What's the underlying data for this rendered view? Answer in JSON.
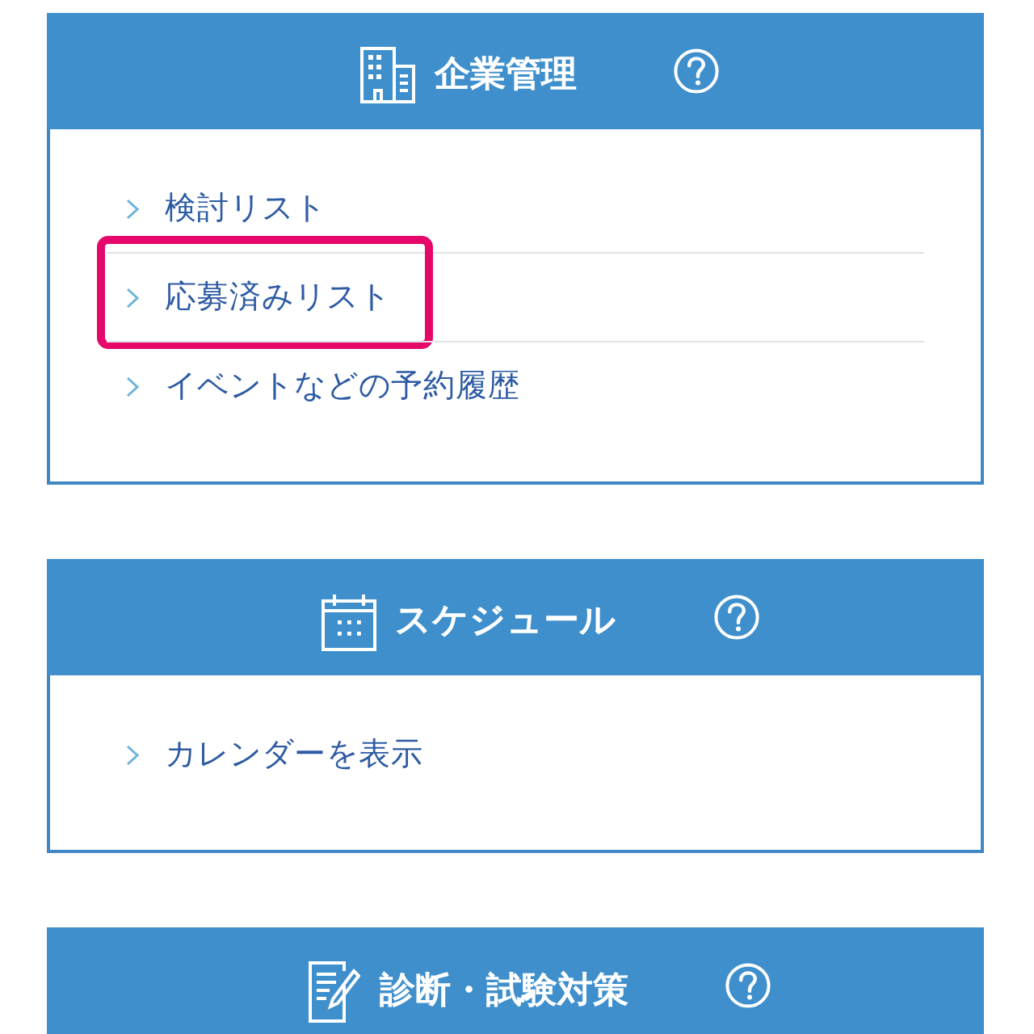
{
  "sections": [
    {
      "title": "企業管理",
      "items": [
        {
          "label": "検討リスト",
          "highlighted": false
        },
        {
          "label": "応募済みリスト",
          "highlighted": true
        },
        {
          "label": "イベントなどの予約履歴",
          "highlighted": false
        }
      ]
    },
    {
      "title": "スケジュール",
      "items": [
        {
          "label": "カレンダーを表示",
          "highlighted": false
        }
      ]
    },
    {
      "title": "診断・試験対策"
    }
  ]
}
